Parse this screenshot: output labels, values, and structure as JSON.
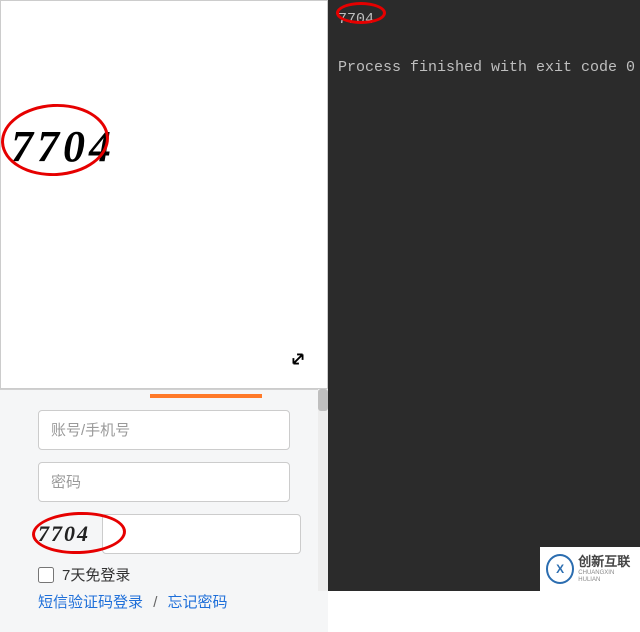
{
  "captcha": {
    "large_value": "7704",
    "small_value": "7704",
    "ring_color": "#e60000"
  },
  "console": {
    "output_line": "7704",
    "status_line": "Process finished with exit code 0"
  },
  "form": {
    "username_placeholder": "账号/手机号",
    "password_placeholder": "密码",
    "remember_label": "7天免登录",
    "sms_login_link": "短信验证码登录",
    "separator": "/",
    "forgot_link": "忘记密码"
  },
  "icons": {
    "expand": "expand"
  },
  "watermark": {
    "cn": "创新互联",
    "en": "CHUANGXIN HULIAN"
  }
}
